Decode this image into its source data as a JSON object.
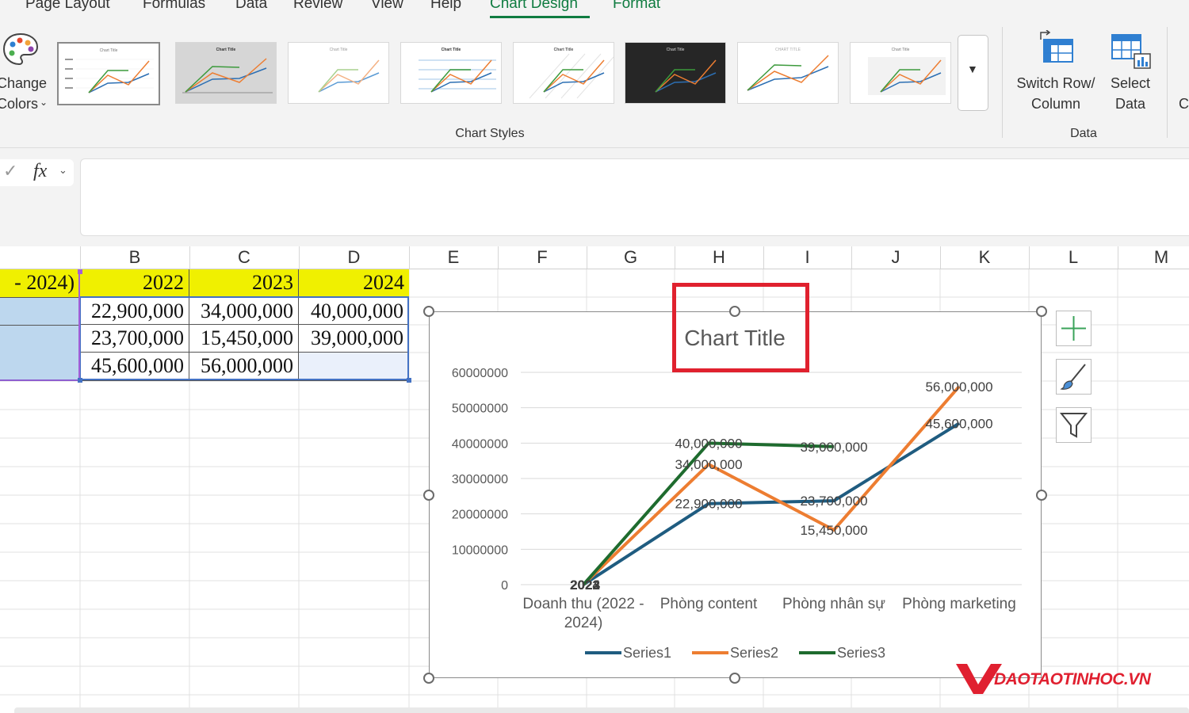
{
  "ribbon_tabs": [
    "Page Layout",
    "Formulas",
    "Data",
    "Review",
    "View",
    "Help",
    "Chart Design",
    "Format"
  ],
  "active_tab": "Chart Design",
  "ribbon": {
    "change_colors_line1": "Change",
    "change_colors_line2": "Colors",
    "chart_styles_label": "Chart Styles",
    "switch_row_line1": "Switch Row/",
    "switch_row_line2": "Column",
    "select_data_line1": "Select",
    "select_data_line2": "Data",
    "data_group_label": "Data",
    "cut_label": "C"
  },
  "formula_bar": {
    "fx_label": "fx",
    "value": ""
  },
  "columns": [
    "B",
    "C",
    "D",
    "E",
    "F",
    "G",
    "H",
    "I",
    "J",
    "K",
    "L",
    "M"
  ],
  "sheet": {
    "header_row": [
      "- 2024)",
      "2022",
      "2023",
      "2024"
    ],
    "rows": [
      [
        "",
        "22,900,000",
        "34,000,000",
        "40,000,000"
      ],
      [
        "",
        "23,700,000",
        "15,450,000",
        "39,000,000"
      ],
      [
        "",
        "45,600,000",
        "56,000,000",
        ""
      ]
    ],
    "header_fill": "#f0f000",
    "row_label_fill": "#bdd7ee"
  },
  "chart_data": {
    "type": "line",
    "title": "Chart Title",
    "categories": [
      "Doanh thu (2022 - 2024)",
      "Phòng content",
      "Phòng nhân sự",
      "Phòng marketing"
    ],
    "category_labels": [
      [
        "Doanh thu (2022 -",
        "2024)"
      ],
      [
        "Phòng content"
      ],
      [
        "Phòng nhân sự"
      ],
      [
        "Phòng marketing"
      ]
    ],
    "series": [
      {
        "name": "Series1",
        "color": "#1f5c80",
        "values": [
          2022,
          22900000,
          23700000,
          45600000
        ],
        "labels": [
          "2022",
          "22,900,000",
          "23,700,000",
          "45,600,000"
        ]
      },
      {
        "name": "Series2",
        "color": "#ed7d31",
        "values": [
          2023,
          34000000,
          15450000,
          56000000
        ],
        "labels": [
          "2023",
          "34,000,000",
          "15,450,000",
          "56,000,000"
        ]
      },
      {
        "name": "Series3",
        "color": "#1e6b2e",
        "values": [
          2024,
          40000000,
          39000000,
          null
        ],
        "labels": [
          "2024",
          "40,000,000",
          "39,000,000",
          ""
        ]
      }
    ],
    "y_ticks": [
      "0",
      "10000000",
      "20000000",
      "30000000",
      "40000000",
      "50000000",
      "60000000"
    ],
    "ylim": [
      0,
      60000000
    ],
    "grid": true,
    "legend": "bottom",
    "title_highlight_color": "#e0212e"
  },
  "chart_side_buttons": [
    "chart-elements",
    "chart-styles",
    "chart-filters"
  ],
  "watermark": {
    "brand": "DAOTAOTINHOC.VN",
    "color": "#e02030"
  }
}
